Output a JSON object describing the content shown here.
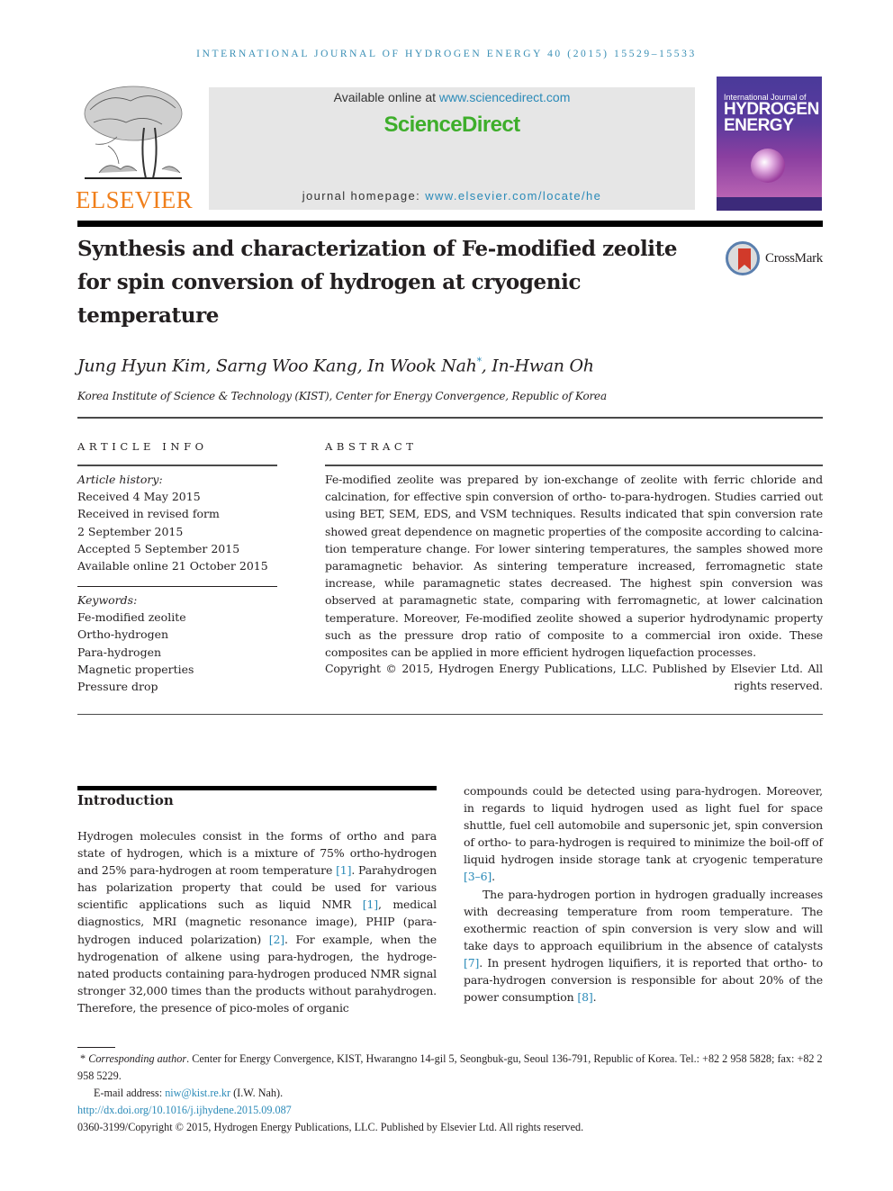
{
  "running_head": "INTERNATIONAL JOURNAL OF HYDROGEN ENERGY 40 (2015) 15529–15533",
  "masthead": {
    "publisher_logo": "ELSEVIER",
    "available_prefix": "Available online at ",
    "available_link": "www.sciencedirect.com",
    "brand": "ScienceDirect",
    "homepage_prefix": "journal homepage: ",
    "homepage_link": "www.elsevier.com/locate/he",
    "cover": {
      "title_small": "International Journal of",
      "title_big_1": "HYDROGEN",
      "title_big_2": "ENERGY"
    },
    "colors": {
      "elsevier_orange": "#f07f1b",
      "sciencedirect_green": "#3eae2b",
      "link_blue": "#2a8ab8"
    }
  },
  "article": {
    "title": "Synthesis and characterization of Fe-modified zeolite for spin conversion of hydrogen at cryogenic temperature",
    "crossmark_label": "CrossMark",
    "authors": [
      {
        "name": "Jung Hyun Kim",
        "sep": ", "
      },
      {
        "name": "Sarng Woo Kang",
        "sep": ", "
      },
      {
        "name": "In Wook Nah",
        "mark": "*",
        "sep": ", "
      },
      {
        "name": "In-Hwan Oh",
        "sep": ""
      }
    ],
    "affiliation": "Korea Institute of Science & Technology (KIST), Center for Energy Convergence, Republic of Korea"
  },
  "article_info": {
    "heading": "ARTICLE INFO",
    "history_label": "Article history:",
    "history": [
      "Received 4 May 2015",
      "Received in revised form",
      "2 September 2015",
      "Accepted 5 September 2015",
      "Available online 21 October 2015"
    ],
    "keywords_label": "Keywords:",
    "keywords": [
      "Fe-modified zeolite",
      "Ortho-hydrogen",
      "Para-hydrogen",
      "Magnetic properties",
      "Pressure drop"
    ]
  },
  "abstract": {
    "heading": "ABSTRACT",
    "text": "Fe-modified zeolite was prepared by ion-exchange of zeolite with ferric chloride and calcination, for effective spin conversion of ortho- to-para-hydrogen. Studies carried out using BET, SEM, EDS, and VSM techniques. Results indicated that spin conversion rate showed great dependence on magnetic properties of the composite according to calcina­tion temperature change. For lower sintering temperatures, the samples showed more paramagnetic behavior. As sintering temperature increased, ferromagnetic state increase, while paramagnetic states decreased. The highest spin conversion was observed at para­magnetic state, comparing with ferromagnetic, at lower calcination temperature. More­over, Fe-modified zeolite showed a superior hydrodynamic property such as the pressure drop ratio of composite to a commercial iron oxide. These composites can be applied in more efficient hydrogen liquefaction processes.",
    "copyright": "Copyright © 2015, Hydrogen Energy Publications, LLC. Published by Elsevier Ltd. All rights reserved."
  },
  "introduction": {
    "heading": "Introduction",
    "left_p1": [
      {
        "t": "Hydrogen molecules consist in the forms of ortho and para state of hydrogen, which is a mixture of 75% ortho-hydrogen and 25% para-hydrogen at room temperature "
      },
      {
        "ref": "[1]"
      },
      {
        "t": ". Para­hydrogen has polarization property that could be used for various scientific applications such as liquid NMR "
      },
      {
        "ref": "[1]"
      },
      {
        "t": ", medical diagnostics, MRI (magnetic resonance image), PHIP (para­hydrogen induced polarization) "
      },
      {
        "ref": "[2]"
      },
      {
        "t": ". For example, when the hydrogenation of alkene using para-hydrogen, the hydroge­nated products containing para-hydrogen produced NMR signal stronger 32,000 times than the products without para­hydrogen. Therefore, the presence of pico-moles of organic compounds could be detected using para-hydrogen. More­over, in regards to liquid hydrogen used as light fuel for space shuttle, fuel cell automobile and supersonic jet, spin conver­sion of ortho- to para-hydrogen is required to minimize the boil-off of liquid hydrogen inside storage tank at cryogenic temperature "
      },
      {
        "ref": "[3–6]"
      },
      {
        "t": "."
      }
    ],
    "right_p2": [
      {
        "t": "The para-hydrogen portion in hydrogen gradually in­creases with decreasing temperature from room temperature. The exothermic reaction of spin conversion is very slow and will take days to approach equilibrium in the absence of cat­alysts "
      },
      {
        "ref": "[7]"
      },
      {
        "t": ". In present hydrogen liquifiers, it is reported that ortho- to para-hydrogen conversion is responsible for about 20% of the power consumption "
      },
      {
        "ref": "[8]"
      },
      {
        "t": "."
      }
    ]
  },
  "left_col_text": "Hydrogen molecules consist in the forms of ortho and para state of hydrogen, which is a mixture of 75% ortho-hydrogen and 25% para-hydrogen at room temperature",
  "footnotes": {
    "star": "*",
    "corr_label": "Corresponding author",
    "corr_text": ". Center for Energy Convergence, KIST, Hwarangno 14-gil 5, Seongbuk-gu, Seoul 136-791, Republic of Korea. Tel.: +82 2 958 5828; fax: +82 2 958 5229.",
    "email_prefix": "E-mail address: ",
    "email": "niw@kist.re.kr",
    "email_suffix": " (I.W. Nah).",
    "doi": "http://dx.doi.org/10.1016/j.ijhydene.2015.09.087",
    "issn_copyright": "0360-3199/Copyright © 2015, Hydrogen Energy Publications, LLC. Published by Elsevier Ltd. All rights reserved."
  }
}
